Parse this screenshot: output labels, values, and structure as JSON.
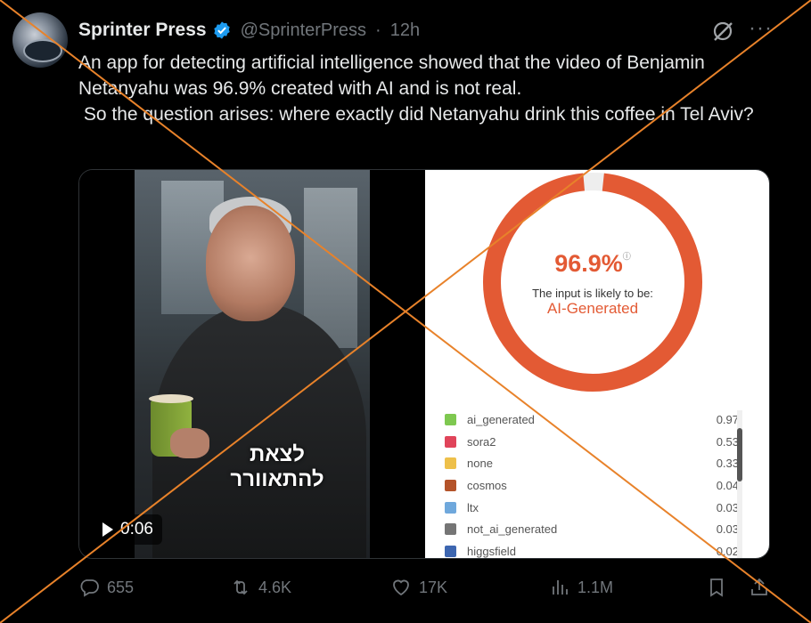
{
  "author": {
    "name": "Sprinter Press",
    "handle": "@SprinterPress",
    "separator": "·",
    "time": "12h"
  },
  "tweet": {
    "text": "An app for detecting artificial intelligence showed that the video of Benjamin Netanyahu was 96.9% created with AI and is not real.\n So the question arises: where exactly did Netanyahu drink this coffee in Tel Aviv?"
  },
  "video": {
    "subtitle": "לצאת להתאוורר",
    "duration": "0:06"
  },
  "detector": {
    "score_text": "96.9%",
    "score_fraction": 0.969,
    "info_glyph": "ⓘ",
    "likely_text": "The input is likely to be:",
    "verdict": "AI-Generated",
    "accent_color": "#e35a34",
    "models": [
      {
        "label": "ai_generated",
        "score": "0.97",
        "color": "#7ec850"
      },
      {
        "label": "sora2",
        "score": "0.53",
        "color": "#e0445a"
      },
      {
        "label": "none",
        "score": "0.33",
        "color": "#eec04a"
      },
      {
        "label": "cosmos",
        "score": "0.04",
        "color": "#b4532a"
      },
      {
        "label": "ltx",
        "score": "0.03",
        "color": "#6fa8dc"
      },
      {
        "label": "not_ai_generated",
        "score": "0.03",
        "color": "#757575"
      },
      {
        "label": "higgsfield",
        "score": "0.02",
        "color": "#3d66b0"
      }
    ]
  },
  "stats": {
    "replies": "655",
    "reposts": "4.6K",
    "likes": "17K",
    "views": "1.1M"
  },
  "overlay": {
    "cross_color": "#e8822a"
  }
}
